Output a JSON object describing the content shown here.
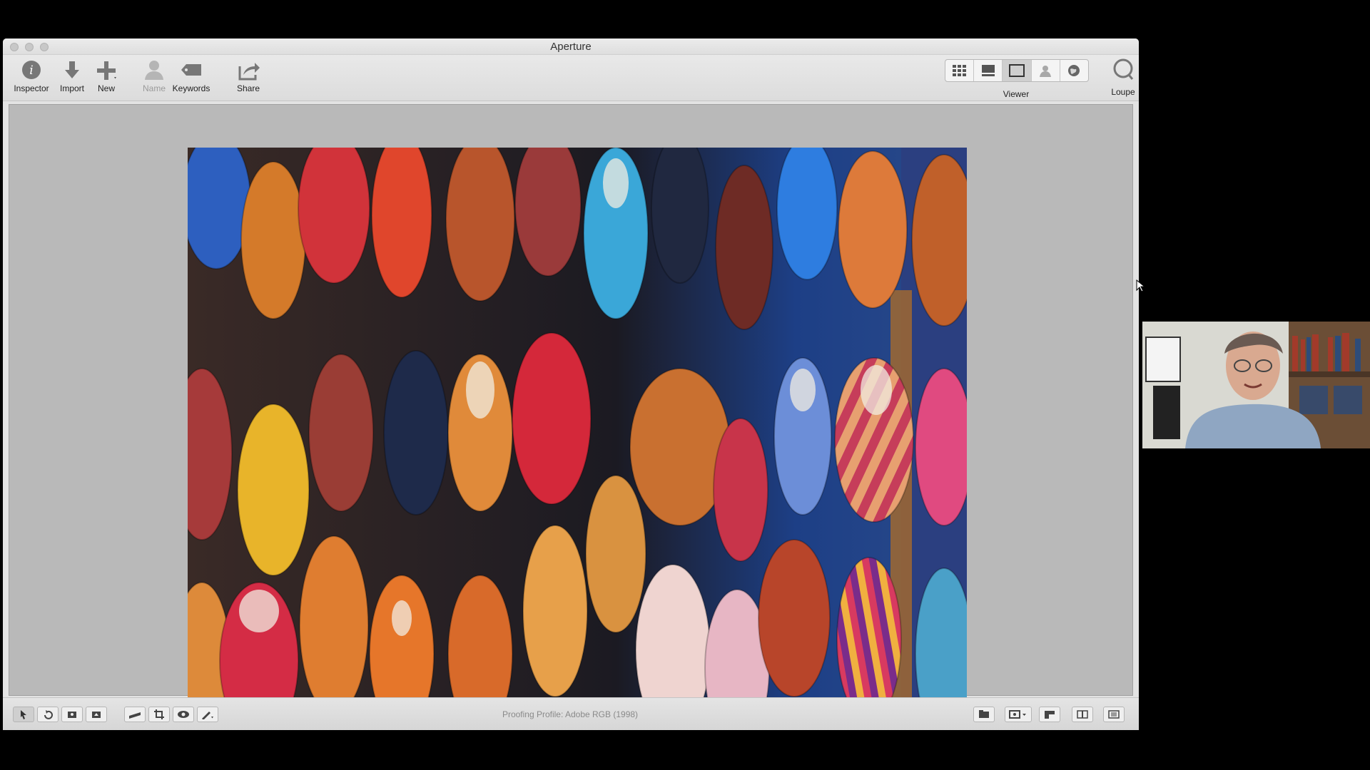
{
  "window": {
    "title": "Aperture"
  },
  "toolbar": {
    "inspector": "Inspector",
    "import": "Import",
    "new": "New",
    "name": "Name",
    "keywords": "Keywords",
    "share": "Share",
    "viewer": "Viewer",
    "loupe": "Loupe"
  },
  "bottombar": {
    "proofing": "Proofing Profile: Adobe RGB (1998)"
  },
  "photo": {
    "subject": "colorful leather slippers hanging at a market stall"
  },
  "colors": {
    "accent": "#3f86e0",
    "window_bg": "#e3e3e3",
    "viewer_bg": "#b9b9b9"
  }
}
